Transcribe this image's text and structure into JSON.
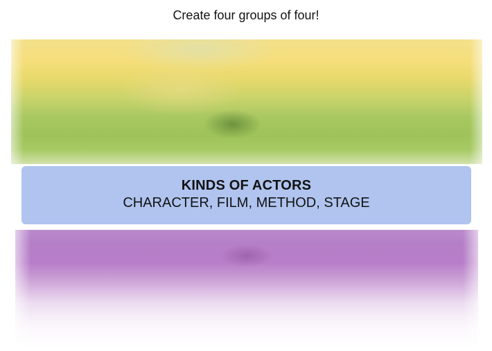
{
  "header": {
    "instructions": "Create four groups of four!"
  },
  "colors": {
    "solved_group_blue": "#b0c4ef",
    "obscured_yellow_green": "#a9c862",
    "obscured_purple": "#b57fc8"
  },
  "solved_groups": [
    {
      "title": "KINDS OF ACTORS",
      "members": "CHARACTER, FILM, METHOD, STAGE"
    }
  ]
}
